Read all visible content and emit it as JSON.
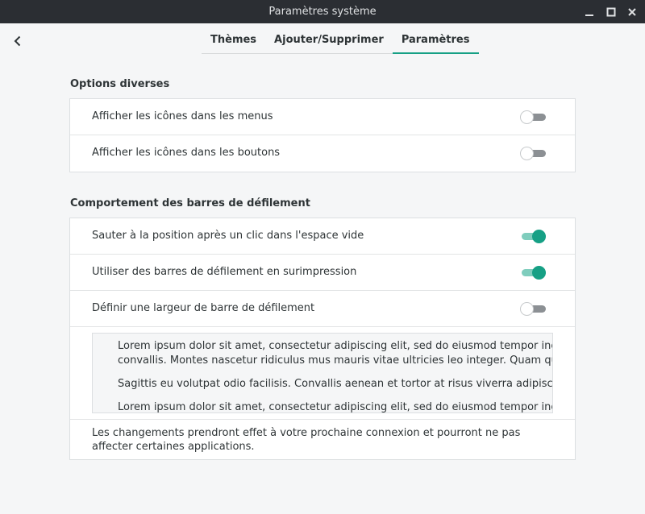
{
  "window": {
    "title": "Paramètres système"
  },
  "tabs": [
    {
      "label": "Thèmes"
    },
    {
      "label": "Ajouter/Supprimer"
    },
    {
      "label": "Paramètres"
    }
  ],
  "misc": {
    "title": "Options diverses",
    "rows": [
      {
        "label": "Afficher les icônes dans les menus",
        "enabled": false
      },
      {
        "label": "Afficher les icônes dans les boutons",
        "enabled": false
      }
    ]
  },
  "scrollbars": {
    "title": "Comportement des barres de défilement",
    "rows": [
      {
        "label": "Sauter à la position après un clic dans l'espace vide",
        "enabled": true
      },
      {
        "label": "Utiliser des barres de défilement en surimpression",
        "enabled": true
      },
      {
        "label": "Définir une largeur de barre de défilement",
        "enabled": false
      }
    ],
    "preview": [
      "Lorem ipsum dolor sit amet, consectetur adipiscing elit, sed do eiusmod tempor incididunt",
      "convallis. Montes nascetur ridiculus mus mauris vitae ultricies leo integer. Quam quisque id d",
      "Sagittis eu volutpat odio facilisis. Convallis aenean et tortor at risus viverra adipiscing at. Sap",
      "Lorem ipsum dolor sit amet, consectetur adipiscing elit, sed do eiusmod tempor incididunt"
    ],
    "note": "Les changements prendront effet à votre prochaine connexion et pourront ne pas affecter certaines applications."
  },
  "colors": {
    "accent": "#16a085",
    "titlebar": "#2b2e33",
    "background": "#f5f6f7"
  }
}
